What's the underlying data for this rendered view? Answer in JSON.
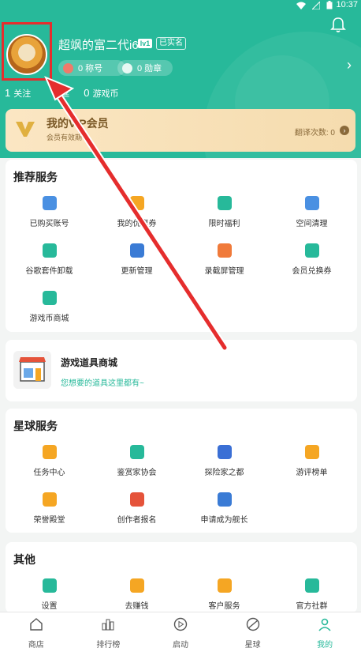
{
  "status": {
    "time": "10:37"
  },
  "profile": {
    "username": "超飒的富二代i6",
    "level": "lv1",
    "verified": "已实名",
    "title_count": "0 称号",
    "medal_count": "0 勋章",
    "follow_num": "1",
    "follow_label": "关注",
    "fans_label": "丝",
    "coins_num": "0",
    "coins_label": "游戏币"
  },
  "vip": {
    "title": "我的VIP会员",
    "subtitle": "会员有效期",
    "translate_label": "翻译次数: 0"
  },
  "recommend": {
    "title": "推荐服务",
    "items": [
      {
        "label": "已购买账号",
        "color": "#4a90e2"
      },
      {
        "label": "我的优惠券",
        "color": "#f5a623"
      },
      {
        "label": "限时福利",
        "color": "#27b99a"
      },
      {
        "label": "空间清理",
        "color": "#4a90e2"
      },
      {
        "label": "谷歌套件卸载",
        "color": "#27b99a"
      },
      {
        "label": "更新管理",
        "color": "#3a7bd5"
      },
      {
        "label": "录截屏管理",
        "color": "#f07a3a"
      },
      {
        "label": "会员兑换券",
        "color": "#27b99a"
      },
      {
        "label": "游戏币商城",
        "color": "#27b99a"
      }
    ]
  },
  "shop": {
    "title": "游戏道具商城",
    "subtitle": "您想要的道具这里都有~"
  },
  "planet": {
    "title": "星球服务",
    "items": [
      {
        "label": "任务中心",
        "color": "#f5a623"
      },
      {
        "label": "鉴赏家协会",
        "color": "#27b99a"
      },
      {
        "label": "探险家之都",
        "color": "#3a6fd5"
      },
      {
        "label": "游评榜单",
        "color": "#f5a623"
      },
      {
        "label": "荣誉殿堂",
        "color": "#f5a623"
      },
      {
        "label": "创作者报名",
        "color": "#e5533a"
      },
      {
        "label": "申请成为舰长",
        "color": "#3a7bd5"
      }
    ]
  },
  "other": {
    "title": "其他",
    "items": [
      {
        "label": "设置",
        "color": "#27b99a"
      },
      {
        "label": "去赚钱",
        "color": "#f5a623"
      },
      {
        "label": "客户服务",
        "color": "#f5a623"
      },
      {
        "label": "官方社群",
        "color": "#27b99a"
      }
    ]
  },
  "tabs": [
    {
      "label": "商店"
    },
    {
      "label": "排行榜"
    },
    {
      "label": "启动"
    },
    {
      "label": "星球"
    },
    {
      "label": "我的"
    }
  ],
  "colors": {
    "brand": "#27b99a",
    "annotation": "#e52d2d"
  }
}
